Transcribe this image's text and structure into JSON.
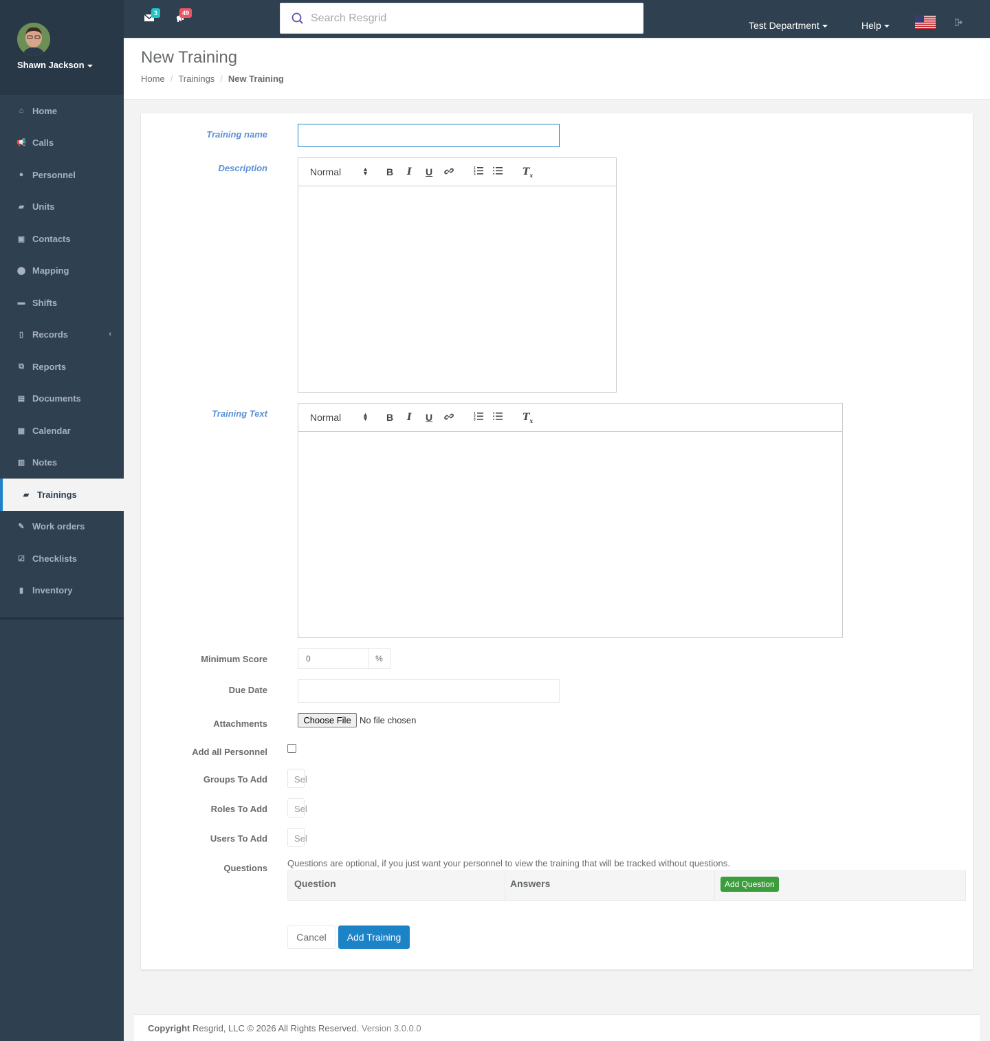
{
  "user": {
    "name": "Shawn Jackson"
  },
  "nav": [
    {
      "label": "Home",
      "icon": "home-icon"
    },
    {
      "label": "Calls",
      "icon": "bullhorn-icon"
    },
    {
      "label": "Personnel",
      "icon": "user-icon"
    },
    {
      "label": "Units",
      "icon": "truck-icon"
    },
    {
      "label": "Contacts",
      "icon": "contact-icon"
    },
    {
      "label": "Mapping",
      "icon": "map-marker-icon"
    },
    {
      "label": "Shifts",
      "icon": "briefcase-icon"
    },
    {
      "label": "Records",
      "icon": "file-icon"
    },
    {
      "label": "Reports",
      "icon": "copy-icon"
    },
    {
      "label": "Documents",
      "icon": "document-icon"
    },
    {
      "label": "Calendar",
      "icon": "calendar-icon"
    },
    {
      "label": "Notes",
      "icon": "notes-icon"
    },
    {
      "label": "Trainings",
      "icon": "book-icon"
    },
    {
      "label": "Work orders",
      "icon": "wrench-icon"
    },
    {
      "label": "Checklists",
      "icon": "check-square-icon"
    },
    {
      "label": "Inventory",
      "icon": "barcode-icon"
    }
  ],
  "topbar": {
    "messages_count": "3",
    "alerts_count": "49",
    "search_placeholder": "Search Resgrid",
    "department": "Test Department",
    "help": "Help"
  },
  "header": {
    "title": "New Training",
    "breadcrumb": [
      "Home",
      "Trainings",
      "New Training"
    ]
  },
  "form": {
    "training_name_label": "Training name",
    "description_label": "Description",
    "training_text_label": "Training Text",
    "editor_format": "Normal",
    "min_score_label": "Minimum Score",
    "min_score_value": "0",
    "min_score_unit": "%",
    "due_date_label": "Due Date",
    "attachments_label": "Attachments",
    "choose_file": "Choose File",
    "no_file": "No file chosen",
    "add_all_label": "Add all Personnel",
    "groups_label": "Groups To Add",
    "roles_label": "Roles To Add",
    "users_label": "Users To Add",
    "select_placeholder": "Sel",
    "questions_label": "Questions",
    "questions_help": "Questions are optional, if you just want your personnel to view the training that will be tracked without questions.",
    "col_question": "Question",
    "col_answers": "Answers",
    "add_question": "Add Question",
    "cancel": "Cancel",
    "submit": "Add Training"
  },
  "footer": {
    "copyright_bold": "Copyright",
    "copyright_text": " Resgrid, LLC © 2026 All Rights Reserved. ",
    "version": "Version 3.0.0.0"
  },
  "colors": {
    "sidebar": "#2f4050",
    "accent": "#1c84c6",
    "badge_teal": "#23c6c8",
    "badge_red": "#ed5565",
    "green": "#3c9d3c"
  }
}
